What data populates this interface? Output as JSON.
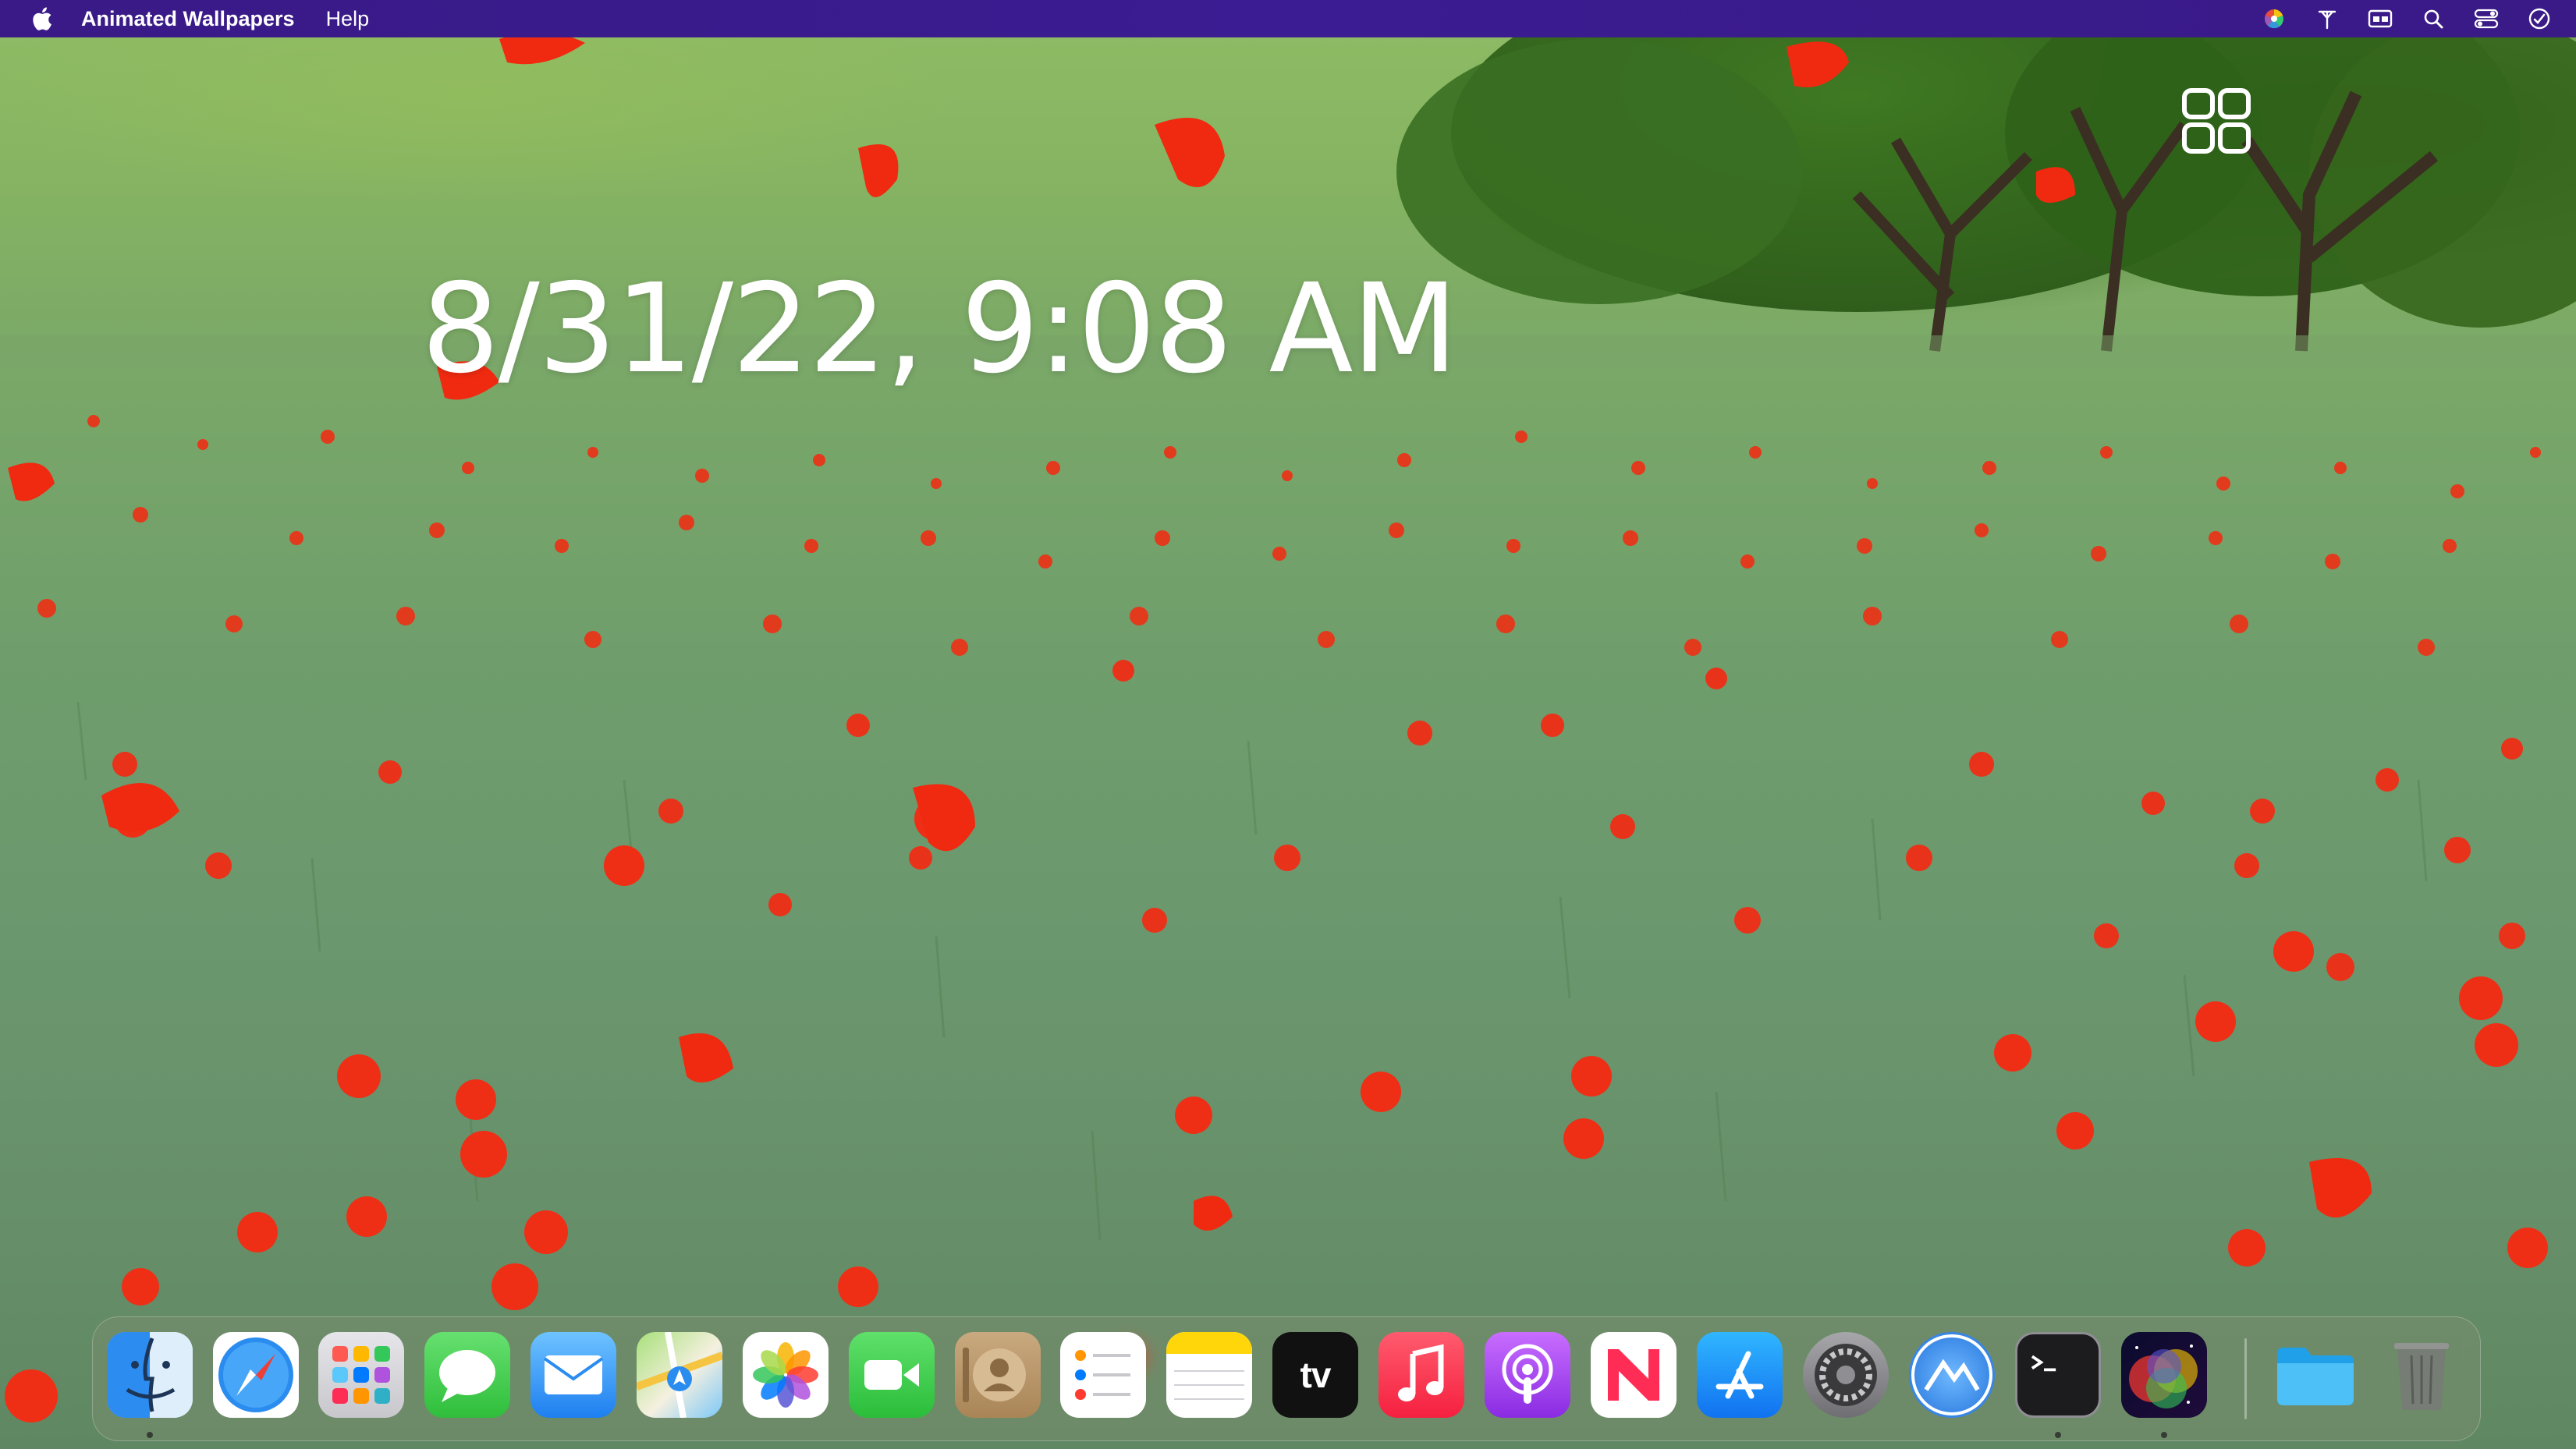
{
  "menubar": {
    "app_name": "Animated Wallpapers",
    "menus": [
      "Help"
    ],
    "status_icons": [
      "color-wheel-icon",
      "pin-icon",
      "window-icon",
      "search-icon",
      "control-center-icon",
      "clock-icon"
    ],
    "background_color": "#3b1c92"
  },
  "desktop": {
    "clock_text": "8/31/22, 9:08 AM",
    "grid_icon": "grid-icon"
  },
  "dock": {
    "apps": [
      {
        "name": "Finder",
        "icon": "finder-icon",
        "running": true
      },
      {
        "name": "Safari",
        "icon": "safari-icon",
        "running": false
      },
      {
        "name": "Launchpad",
        "icon": "launchpad-icon",
        "running": false
      },
      {
        "name": "Messages",
        "icon": "messages-icon",
        "running": false
      },
      {
        "name": "Mail",
        "icon": "mail-icon",
        "running": false
      },
      {
        "name": "Maps",
        "icon": "maps-icon",
        "running": false
      },
      {
        "name": "Photos",
        "icon": "photos-icon",
        "running": false
      },
      {
        "name": "FaceTime",
        "icon": "facetime-icon",
        "running": false
      },
      {
        "name": "Contacts",
        "icon": "contacts-icon",
        "running": false
      },
      {
        "name": "Reminders",
        "icon": "reminders-icon",
        "running": false
      },
      {
        "name": "Notes",
        "icon": "notes-icon",
        "running": false
      },
      {
        "name": "TV",
        "icon": "tv-icon",
        "label": "tv",
        "running": false
      },
      {
        "name": "Music",
        "icon": "music-icon",
        "running": false
      },
      {
        "name": "Podcasts",
        "icon": "podcasts-icon",
        "running": false
      },
      {
        "name": "News",
        "icon": "news-icon",
        "running": false
      },
      {
        "name": "App Store",
        "icon": "app-store-icon",
        "running": false
      },
      {
        "name": "System Preferences",
        "icon": "system-preferences-icon",
        "running": false
      },
      {
        "name": "Monterey Installer",
        "icon": "mountain-icon",
        "running": false
      },
      {
        "name": "Terminal",
        "icon": "terminal-icon",
        "running": true
      },
      {
        "name": "Animated Wallpapers",
        "icon": "animated-wallpapers-icon",
        "running": true
      }
    ],
    "folder": {
      "name": "Downloads",
      "icon": "folder-icon"
    },
    "trash": {
      "name": "Trash",
      "icon": "trash-icon"
    }
  }
}
